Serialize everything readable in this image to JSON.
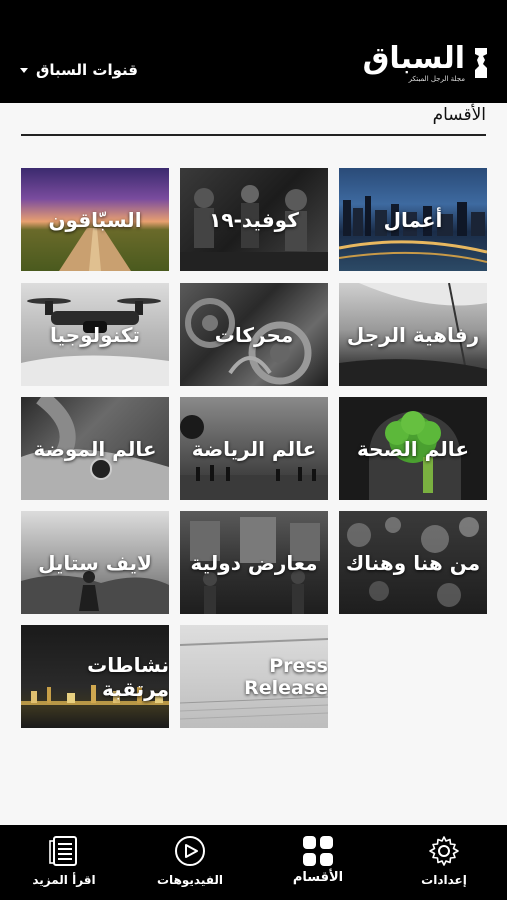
{
  "header": {
    "logo_text": "السباق",
    "logo_subtitle": "مجلة الرجل المبتكر",
    "channels_label": "قنوات السباق"
  },
  "section": {
    "title": "الأقسام"
  },
  "tiles": [
    {
      "label": "أعمال",
      "icon": "city-night-skyline"
    },
    {
      "label": "كوفيد-١٩",
      "icon": "people-crowd-photo"
    },
    {
      "label": "السبّاقون",
      "icon": "sunset-road-photo"
    },
    {
      "label": "رفاهية الرجل",
      "icon": "sailboat-photo"
    },
    {
      "label": "محركات",
      "icon": "engine-gears-photo"
    },
    {
      "label": "تكنولوجيا",
      "icon": "drone-photo"
    },
    {
      "label": "عالم الصحة",
      "icon": "broccoli-brain-photo"
    },
    {
      "label": "عالم الرياضة",
      "icon": "soccer-players-photo"
    },
    {
      "label": "عالم الموضة",
      "icon": "watch-wrist-photo"
    },
    {
      "label": "من هنا وهناك",
      "icon": "bokeh-lights-photo"
    },
    {
      "label": "معارض دولية",
      "icon": "exhibition-crowd-photo"
    },
    {
      "label": "لايف ستايل",
      "icon": "man-sitting-photo"
    },
    {
      "label": "نشاطات مرتقبة",
      "icon": "city-lights-photo"
    },
    {
      "label": "Press Release",
      "icon": "newspaper-photo"
    }
  ],
  "bottom_nav": [
    {
      "label": "إعدادات",
      "icon": "gear-icon"
    },
    {
      "label": "الأقسام",
      "icon": "grid-icon"
    },
    {
      "label": "الفيديوهات",
      "icon": "play-icon"
    },
    {
      "label": "اقرأ المزيد",
      "icon": "document-icon"
    }
  ],
  "colors": {
    "header_bg": "#000000",
    "page_bg": "#f7f7f7",
    "text_dark": "#111111"
  }
}
